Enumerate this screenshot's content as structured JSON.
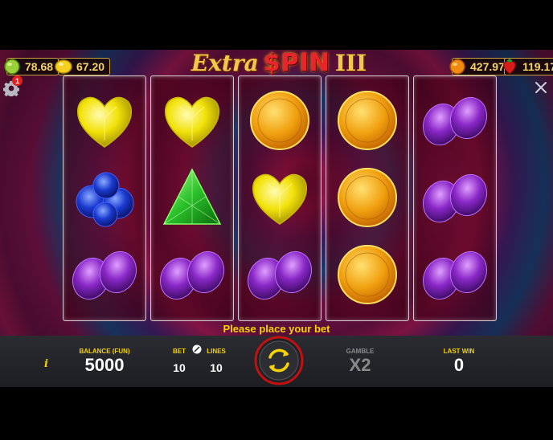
{
  "title": {
    "extra": "Extra",
    "spin": "$PIN",
    "three": "III"
  },
  "jackpots": {
    "lime": "78.68",
    "lemon": "67.20",
    "orange": "427.97",
    "strawberry": "119.17"
  },
  "settings_badge": "1",
  "reels": [
    [
      "yellow-heart-gem",
      "blue-sapphire-cluster",
      "purple-amethyst-pair"
    ],
    [
      "yellow-heart-gem",
      "green-triangle-gem",
      "purple-amethyst-pair"
    ],
    [
      "gold-coin",
      "yellow-heart-gem",
      "purple-amethyst-pair"
    ],
    [
      "gold-coin",
      "gold-coin",
      "gold-coin"
    ],
    [
      "purple-amethyst-pair",
      "purple-amethyst-pair",
      "purple-amethyst-pair"
    ]
  ],
  "message": "Please place your bet",
  "info_label": "i",
  "balance": {
    "label": "BALANCE (FUN)",
    "value": "5000"
  },
  "bet": {
    "label": "BET",
    "value": "10"
  },
  "lines": {
    "label": "LINES",
    "value": "10"
  },
  "gamble": {
    "label": "GAMBLE",
    "value": "X2"
  },
  "last_win": {
    "label": "LAST WIN",
    "value": "0"
  },
  "colors": {
    "accent": "#f7d300",
    "reel_border": "#d7c9cf",
    "bar": "#1c1e22"
  }
}
